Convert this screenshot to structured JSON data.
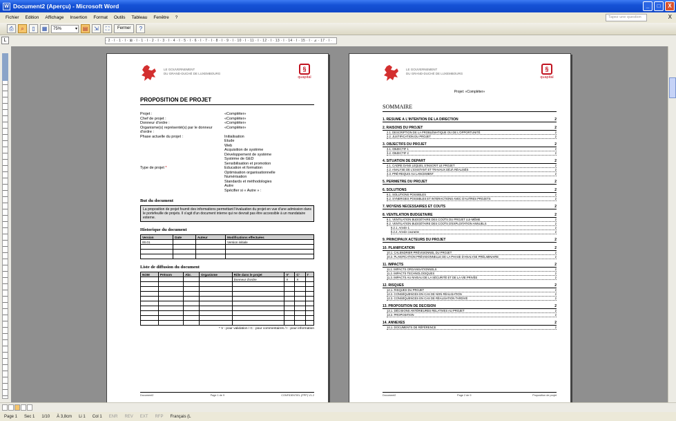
{
  "window": {
    "title": "Document2 (Aperçu) - Microsoft Word",
    "buttons": [
      "_",
      "□",
      "X"
    ]
  },
  "menubar": {
    "items": [
      "Fichier",
      "Edition",
      "Affichage",
      "Insertion",
      "Format",
      "Outils",
      "Tableau",
      "Fenêtre",
      "?"
    ],
    "ask_placeholder": "Tapez une question",
    "close": "X"
  },
  "toolbar": {
    "zoom": "75%",
    "close_label": "Fermer"
  },
  "ruler": {
    "text": "· 2 · I · 1 · I · ⊠ · I · 1 · I · 2 · I · 3 · I · 4 · I · 5 · I · 6 · I · 7 · I · 8 · I · 9 · I · 10 · I · 11 · I · 12 · I · 13 · I · 14 · I · 15 · I · ⊿ · 17 · I ·"
  },
  "status": {
    "page": "Page 1",
    "sec": "Sec 1",
    "pages": "1/10",
    "at": "À 3,8cm",
    "line": "Li 1",
    "col": "Col 1",
    "modes": [
      "ENR",
      "REV",
      "EXT",
      "RFP"
    ],
    "lang": "Français (L"
  },
  "page1": {
    "gov": [
      "LE GOUVERNEMENT",
      "DU GRAND-DUCHÉ DE LUXEMBOURG"
    ],
    "logo": "quapital",
    "title": "PROPOSITION DE PROJET",
    "fields": [
      {
        "label": "Projet :",
        "value": "«Compléter»"
      },
      {
        "label": "Chef de projet :",
        "value": "«Compléter»"
      },
      {
        "label": "Donneur d'ordre :",
        "value": "«Compléter»"
      },
      {
        "label": "Organisme(s) représenté(s) par le donneur d'ordre :",
        "value": "«Compléter»"
      },
      {
        "label": "Phase actuelle du projet :",
        "value": "Initialisation"
      }
    ],
    "phases": [
      "Etude",
      "Web",
      "Acquisition de système",
      "Développement de système",
      "Système de GED"
    ],
    "type_label": "Type de projet",
    "types": [
      "Sensibilisation et promotion",
      "Education et formation",
      "Optimisation organisationnelle",
      "Numérisation",
      "Standards et méthodologies",
      "Autre",
      "Spécifier si « Autre » :"
    ],
    "but_title": "But du document",
    "but_text": "La proposition de projet fournit des informations permettant l'évaluation du projet en vue d'une admission dans le portefeuille de projets. Il s'agit d'un document interne qui ne devrait pas être accessible à un mandataire externe.",
    "hist_title": "Historique du document",
    "hist_cols": [
      "Version",
      "Date",
      "Auteur",
      "Modifications effectuées"
    ],
    "hist_rows": [
      [
        "00.01",
        "",
        "",
        "Version initiale"
      ],
      [
        "",
        "",
        "",
        ""
      ],
      [
        "",
        "",
        "",
        ""
      ],
      [
        "",
        "",
        "",
        ""
      ]
    ],
    "diff_title": "Liste de diffusion du document",
    "diff_cols": [
      "NOM",
      "Prénom",
      "Abr.",
      "Organisme",
      "Rôle dans le projet",
      "V'",
      "C'",
      "I'"
    ],
    "diff_rows": [
      [
        "",
        "",
        "",
        "",
        "Donneur d'ordre",
        "X",
        "X",
        ""
      ],
      [
        "",
        "",
        "",
        "",
        "",
        "",
        "",
        ""
      ],
      [
        "",
        "",
        "",
        "",
        "",
        "",
        "",
        ""
      ],
      [
        "",
        "",
        "",
        "",
        "",
        "",
        "",
        ""
      ],
      [
        "",
        "",
        "",
        "",
        "",
        "",
        "",
        ""
      ],
      [
        "",
        "",
        "",
        "",
        "",
        "",
        "",
        ""
      ],
      [
        "",
        "",
        "",
        "",
        "",
        "",
        "",
        ""
      ],
      [
        "",
        "",
        "",
        "",
        "",
        "",
        "",
        ""
      ],
      [
        "",
        "",
        "",
        "",
        "",
        "",
        "",
        ""
      ],
      [
        "",
        "",
        "",
        "",
        "",
        "",
        "",
        ""
      ]
    ],
    "diff_note": "* V : pour validation / C : pour commentaires / I : pour information",
    "footer": [
      "Document2",
      "Page 1 de 9",
      "CONFIDENTIEL (PPP) V1.2"
    ]
  },
  "page2": {
    "gov": [
      "LE GOUVERNEMENT",
      "DU GRAND-DUCHÉ DE LUXEMBOURG"
    ],
    "logo": "quapital",
    "subtitle": "Projet: «Compléter»",
    "toc_title": "SOMMAIRE",
    "toc": [
      {
        "title": "1. RÉSUMÉ À L'INTENTION DE LA DIRECTION",
        "page": "2",
        "subs": []
      },
      {
        "title": "2. RAISONS DU PROJET",
        "page": "2",
        "subs": [
          [
            "2.1. DESCRIPTION DE LA PROBLÉMATIQUE OU DE L'OPPORTUNITÉ",
            "2"
          ],
          [
            "2.2. JUSTIFICATION DU PROJET",
            "2"
          ]
        ]
      },
      {
        "title": "3. OBJECTIFS DU PROJET",
        "page": "2",
        "subs": [
          [
            "3.1. OBJECTIF 1",
            "2"
          ],
          [
            "3.2. OBJECTIF 2",
            "2"
          ]
        ]
      },
      {
        "title": "4. SITUATION DE DÉPART",
        "page": "2",
        "subs": [
          [
            "4.1. CADRE DANS LEQUEL S'INSCRIT LE PROJET",
            "2"
          ],
          [
            "4.2. ANALYSE DE L'EXISTANT ET TRAVAUX DÉJÀ RÉALISÉS",
            "2"
          ],
          [
            "4.3. PRÉ-REQUIS AU LANCEMENT",
            "2"
          ]
        ]
      },
      {
        "title": "5. PÉRIMÈTRE DU PROJET",
        "page": "2",
        "subs": []
      },
      {
        "title": "6. SOLUTIONS",
        "page": "2",
        "subs": [
          [
            "6.1. SOLUTIONS POSSIBLES",
            "2"
          ],
          [
            "6.2. SYNERGIES POSSIBLES ET INTERACTIONS AVEC D'AUTRES PROJETS",
            "2"
          ]
        ]
      },
      {
        "title": "7. MOYENS NÉCESSAIRES ET COÛTS",
        "page": "2",
        "subs": []
      },
      {
        "title": "8. VENTILATION BUDGÉTAIRE",
        "page": "2",
        "subs": [
          [
            "8.1. VENTILATION BUDGÉTAIRE DES COÛTS DU PROJET LUI-MÊME",
            "2"
          ],
          [
            "8.2. VENTILATION BUDGÉTAIRE DES COÛTS D'EXPLOITATION ANNUELS",
            "2"
          ],
          [
            "8.2.1. Année 1",
            "2"
          ],
          [
            "8.2.2. Année courante",
            "2"
          ]
        ]
      },
      {
        "title": "9. PRINCIPAUX ACTEURS DU PROJET",
        "page": "2",
        "subs": []
      },
      {
        "title": "10. PLANIFICATION",
        "page": "2",
        "subs": [
          [
            "10.1. CALENDRIER PRÉVISIONNEL DU PROJET",
            "2"
          ],
          [
            "10.2. PLANIFICATION PRÉVISIONNELLE DE LA PHASE D'ANALYSE PRÉLIMINAIRE",
            "2"
          ]
        ]
      },
      {
        "title": "11. IMPACTS",
        "page": "2",
        "subs": [
          [
            "11.1. IMPACTS ORGANISATIONNELS",
            "2"
          ],
          [
            "11.2. IMPACTS TECHNOLOGIQUES",
            "2"
          ],
          [
            "11.3. IMPACTS AU NIVEAU DE LA SÉCURITÉ ET DE LA VIE PRIVÉE",
            "2"
          ]
        ]
      },
      {
        "title": "12. RISQUES",
        "page": "2",
        "subs": [
          [
            "12.1. RISQUES DU PROJET",
            "2"
          ],
          [
            "12.2. CONSÉQUENCES EN CAS DE NON RÉALISATION",
            "2"
          ],
          [
            "12.3. CONSÉQUENCES EN CAS DE RÉALISATION TARDIVE",
            "2"
          ]
        ]
      },
      {
        "title": "13. PROPOSITION DE DÉCISION",
        "page": "2",
        "subs": [
          [
            "13.1. DÉCISIONS ANTÉRIEURES RELATIVES AU PROJET",
            "2"
          ],
          [
            "13.2. PROPOSITION",
            "2"
          ]
        ]
      },
      {
        "title": "14. ANNEXES",
        "page": "2",
        "subs": [
          [
            "14.1. DOCUMENTS DE RÉFÉRENCE",
            "2"
          ]
        ]
      }
    ],
    "footer": [
      "Document2",
      "Page 2 de 9",
      "Proposition de projet"
    ]
  }
}
